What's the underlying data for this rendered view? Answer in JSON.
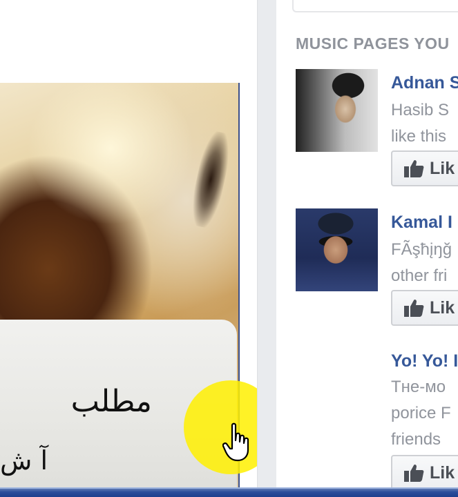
{
  "post": {
    "photo_caption_line1": "مطلب",
    "photo_caption_line2": "آ ش"
  },
  "sidebar": {
    "section_title": "MUSIC PAGES YOU",
    "suggestions": [
      {
        "name": "Adnan S",
        "line1": "Hasib S",
        "line2": "like this",
        "like_label": "Lik",
        "thumb_icon": "profile-photo"
      },
      {
        "name": "Kamal I",
        "line1": "FÃşħįŋğ",
        "line2": "other fri",
        "like_label": "Lik",
        "thumb_icon": "profile-photo"
      },
      {
        "name": "Yo! Yo! I",
        "line1": "Tнe-мo",
        "line2": "porice F",
        "line3": "friends",
        "like_label": "Lik"
      }
    ]
  },
  "colors": {
    "link_blue": "#365899",
    "secondary_text": "#90949c",
    "section_title": "#8f939b",
    "cursor_highlight": "#fff000",
    "taskbar": "#2b4d9b"
  }
}
